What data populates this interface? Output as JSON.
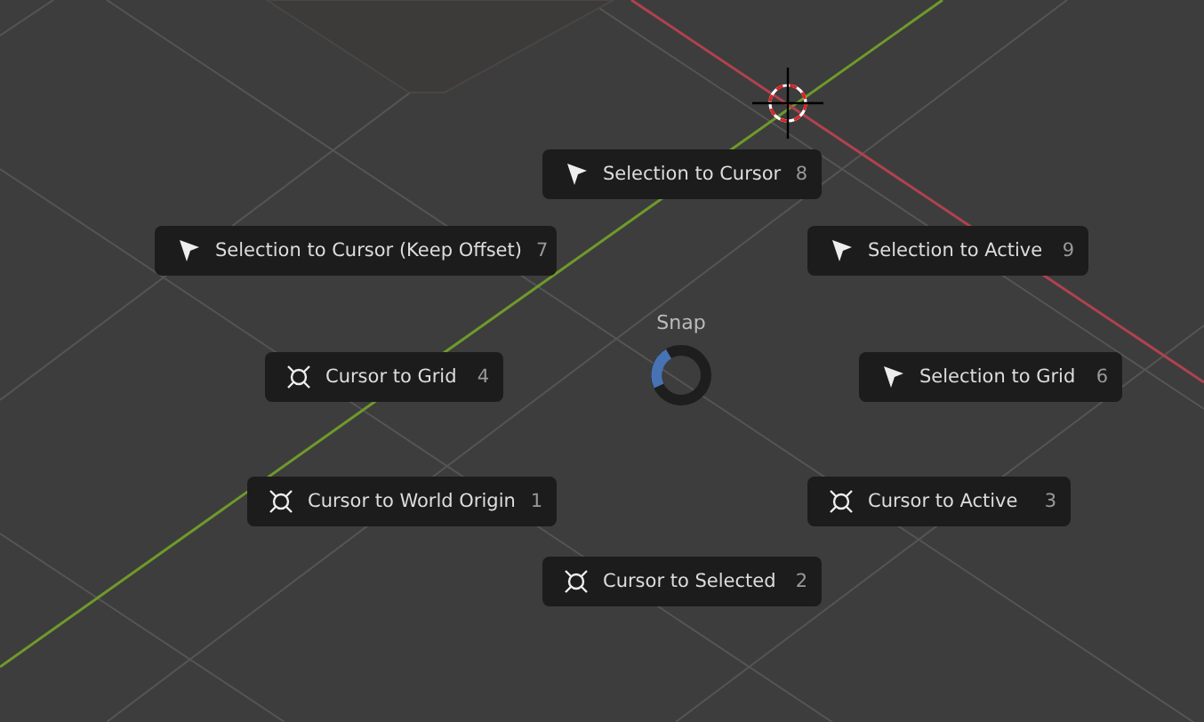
{
  "pie_menu": {
    "title": "Snap",
    "items": [
      {
        "label": "Selection to Cursor",
        "shortcut": "8",
        "kind": "selection"
      },
      {
        "label": "Selection to Cursor (Keep Offset)",
        "shortcut": "7",
        "kind": "selection"
      },
      {
        "label": "Selection to Active",
        "shortcut": "9",
        "kind": "selection"
      },
      {
        "label": "Cursor to Grid",
        "shortcut": "4",
        "kind": "cursor"
      },
      {
        "label": "Selection to Grid",
        "shortcut": "6",
        "kind": "selection"
      },
      {
        "label": "Cursor to World Origin",
        "shortcut": "1",
        "kind": "cursor"
      },
      {
        "label": "Cursor to Active",
        "shortcut": "3",
        "kind": "cursor"
      },
      {
        "label": "Cursor to Selected",
        "shortcut": "2",
        "kind": "cursor"
      }
    ]
  }
}
